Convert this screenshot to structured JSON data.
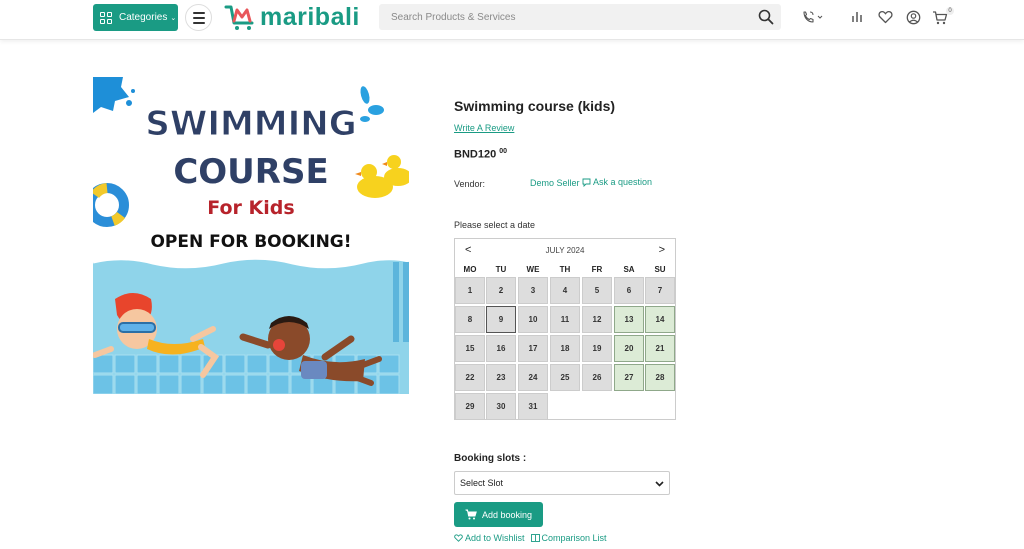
{
  "header": {
    "categories_label": "Categories",
    "logo_text": "maribali",
    "search_placeholder": "Search Products & Services",
    "cart_count": "0"
  },
  "image": {
    "line1": "SWIMMING",
    "line2": "COURSE",
    "line3": "For Kids",
    "line4": "OPEN FOR BOOKING!"
  },
  "product": {
    "title": "Swimming course (kids)",
    "review_link": "Write A Review",
    "price_main": "BND120",
    "price_cents": "00",
    "vendor_label": "Vendor:",
    "vendor_name": "Demo Seller",
    "ask_question": "Ask a question",
    "date_label": "Please select a date"
  },
  "calendar": {
    "prev": "<",
    "next": ">",
    "month": "JULY 2024",
    "weekdays": [
      "MO",
      "TU",
      "WE",
      "TH",
      "FR",
      "SA",
      "SU"
    ],
    "days": [
      "1",
      "2",
      "3",
      "4",
      "5",
      "6",
      "7",
      "8",
      "9",
      "10",
      "11",
      "12",
      "13",
      "14",
      "15",
      "16",
      "17",
      "18",
      "19",
      "20",
      "21",
      "22",
      "23",
      "24",
      "25",
      "26",
      "27",
      "28",
      "29",
      "30",
      "31"
    ],
    "today": "9",
    "available": [
      "13",
      "14",
      "20",
      "21",
      "27",
      "28"
    ]
  },
  "booking": {
    "slots_label": "Booking slots :",
    "select_value": "Select Slot",
    "add_button": "Add booking",
    "wishlist": "Add to Wishlist",
    "comparison": "Comparison List"
  },
  "colors": {
    "brand": "#1a9b84",
    "available_day": "#dcebd6"
  }
}
